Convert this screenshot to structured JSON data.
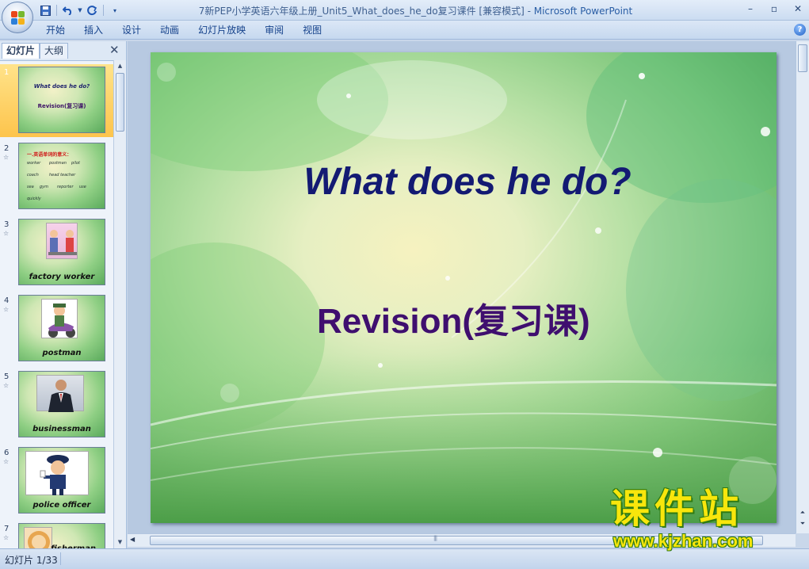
{
  "window": {
    "title_doc": "7新PEP小学英语六年级上册_Unit5_What_does_he_do复习课件 [兼容模式]",
    "title_sep": " - ",
    "title_app": "Microsoft PowerPoint"
  },
  "ribbon": {
    "tabs": [
      "开始",
      "插入",
      "设计",
      "动画",
      "幻灯片放映",
      "审阅",
      "视图"
    ]
  },
  "left_pane": {
    "tabs": [
      "幻灯片",
      "大纲"
    ],
    "slides": [
      {
        "num": "1",
        "title": "What does  he  do?",
        "sub": "Revision(复习课)"
      },
      {
        "num": "2",
        "red": "一.英语单词的意义：",
        "words": [
          "worker",
          "postman",
          "pilot",
          "coach",
          "head teacher",
          "",
          "sea",
          "gym",
          "reporter",
          "use",
          "quickly"
        ]
      },
      {
        "num": "3",
        "caption": "factory worker"
      },
      {
        "num": "4",
        "caption": "postman"
      },
      {
        "num": "5",
        "caption": "businessman"
      },
      {
        "num": "6",
        "caption": "police officer"
      },
      {
        "num": "7",
        "caption": "fisherman"
      }
    ]
  },
  "slide": {
    "title": "What does  he  do?",
    "subtitle": "Revision(复习课)"
  },
  "status": {
    "text": "幻灯片 1/33"
  },
  "watermark": {
    "cn": "课件站",
    "url": "www.kjzhan.com"
  },
  "colors": {
    "title_text": "#131a73",
    "subtitle_text": "#3f0f6f",
    "selection": "#fdc44c",
    "watermark": "#f8e60c"
  },
  "icons": [
    "office-button-icon",
    "save-icon",
    "undo-icon",
    "redo-icon",
    "customize-qat-icon",
    "minimize-icon",
    "maximize-icon",
    "close-icon",
    "help-icon",
    "pane-close-icon"
  ]
}
